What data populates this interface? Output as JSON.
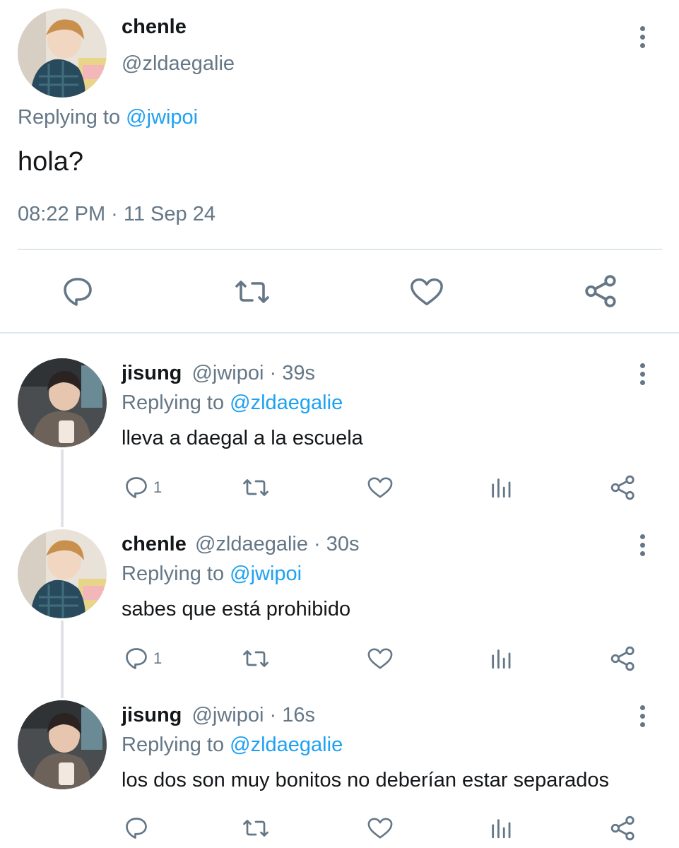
{
  "main_tweet": {
    "display_name": "chenle",
    "handle": "@zldaegalie",
    "replying_prefix": "Replying to",
    "replying_to": "@jwipoi",
    "text": "hola?",
    "timestamp": "08:22 PM · 11 Sep 24"
  },
  "replies": [
    {
      "display_name": "jisung",
      "handle": "@jwipoi",
      "time": "· 39s",
      "replying_prefix": "Replying to",
      "replying_to": "@zldaegalie",
      "text": "lleva a daegal a la escuela",
      "reply_count": "1"
    },
    {
      "display_name": "chenle",
      "handle": "@zldaegalie",
      "time": "· 30s",
      "replying_prefix": "Replying to",
      "replying_to": "@jwipoi",
      "text": "sabes que está prohibido",
      "reply_count": "1"
    },
    {
      "display_name": "jisung",
      "handle": "@jwipoi",
      "time": "· 16s",
      "replying_prefix": "Replying to",
      "replying_to": "@zldaegalie",
      "text": "los dos son muy bonitos no deberían estar separados",
      "reply_count": ""
    }
  ],
  "icons": {
    "reply": "speech-bubble-icon",
    "retweet": "retweet-icon",
    "like": "heart-icon",
    "analytics": "bar-chart-icon",
    "share": "share-icon",
    "more": "vertical-dots-icon"
  },
  "colors": {
    "link": "#1da1f2",
    "muted": "#657786",
    "text": "#14171a",
    "divider": "#e1e8ed"
  }
}
